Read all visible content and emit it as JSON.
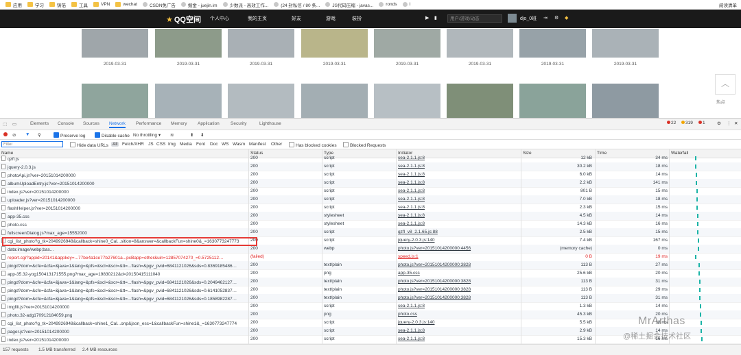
{
  "bookmarks": {
    "items": [
      "应用",
      "学习",
      "铸箔",
      "工具",
      "VPN",
      "wechat",
      "CSDN免广告",
      "掘金 - juejin.im",
      "少数派 - 高效工作...",
      "(24 封私信 / 80 条...",
      "JS代码压缩 - javas...",
      "ronds",
      "I"
    ],
    "right": "阅读清单"
  },
  "site_header": {
    "logo": "QQ空间",
    "nav": [
      "个人中心",
      "我的主页",
      "好友",
      "游戏",
      "装扮"
    ],
    "search_placeholder": "用户/游戏/动态",
    "username": "djo_0班"
  },
  "gallery": {
    "dates": [
      "2019-03-31",
      "2019-03-31",
      "2019-03-31",
      "2019-03-31",
      "2019-03-31",
      "2019-03-31",
      "2019-03-31",
      "2019-03-31"
    ],
    "side_label": "热点"
  },
  "devtools": {
    "tabs": [
      "Elements",
      "Console",
      "Sources",
      "Network",
      "Performance",
      "Memory",
      "Application",
      "Security",
      "Lighthouse"
    ],
    "badges": {
      "errors": "22",
      "warnings": "319",
      "issues": "1"
    },
    "toolbar": {
      "preserve_log": "Preserve log",
      "disable_cache": "Disable cache",
      "throttling": "No throttling"
    },
    "filter": {
      "placeholder": "Filter",
      "hide_data_urls": "Hide data URLs",
      "types": [
        "All",
        "Fetch/XHR",
        "JS",
        "CSS",
        "Img",
        "Media",
        "Font",
        "Doc",
        "WS",
        "Wasm",
        "Manifest",
        "Other"
      ],
      "blocked_cookies": "Has blocked cookies",
      "blocked_requests": "Blocked Requests"
    },
    "columns": {
      "name": "Name",
      "status": "Status",
      "type": "Type",
      "initiator": "Initiator",
      "size": "Size",
      "time": "Time",
      "waterfall": "Waterfall"
    },
    "rows": [
      {
        "name": "qzfl.js",
        "status": "200",
        "type": "script",
        "initiator": "sea-2.1.1.js:8",
        "size": "12 kB",
        "time": "34 ms"
      },
      {
        "name": "jquery-2.0.3.js",
        "status": "200",
        "type": "script",
        "initiator": "sea-2.1.1.js:8",
        "size": "30.2 kB",
        "time": "18 ms"
      },
      {
        "name": "photoApi.js?ver=20151014200000",
        "status": "200",
        "type": "script",
        "initiator": "sea-2.1.1.js:8",
        "size": "6.0 kB",
        "time": "14 ms"
      },
      {
        "name": "albumUploadEntry.js?ver=20151014200000",
        "status": "200",
        "type": "script",
        "initiator": "sea-2.1.1.js:8",
        "size": "2.2 kB",
        "time": "141 ms"
      },
      {
        "name": "index.js?ver=20151014200000",
        "status": "200",
        "type": "script",
        "initiator": "sea-2.1.1.js:8",
        "size": "801 B",
        "time": "15 ms"
      },
      {
        "name": "uploader.js?ver=20151014200000",
        "status": "200",
        "type": "script",
        "initiator": "sea-2.1.1.js:8",
        "size": "7.0 kB",
        "time": "18 ms"
      },
      {
        "name": "flashHelper.js?ver=20151014200000",
        "status": "200",
        "type": "script",
        "initiator": "sea-2.1.1.js:8",
        "size": "2.3 kB",
        "time": "15 ms"
      },
      {
        "name": "app-35.css",
        "status": "200",
        "type": "stylesheet",
        "initiator": "sea-2.1.1.js:8",
        "size": "4.5 kB",
        "time": "14 ms"
      },
      {
        "name": "photo.css",
        "status": "200",
        "type": "stylesheet",
        "initiator": "sea-2.1.1.js:8",
        "size": "14.3 kB",
        "time": "16 ms"
      },
      {
        "name": "fullscreenDialog.js?max_age=15552000",
        "status": "200",
        "type": "script",
        "initiator": "qzfl_v8_2.1.65.js:88",
        "size": "2.5 kB",
        "time": "15 ms"
      },
      {
        "name": "cgi_list_photo?g_tk=2049926948&callback=shine0_Cal...sition=8&answer=&callbackFun=shine0&_=1630773247773",
        "status": "200",
        "type": "script",
        "initiator": "jquery-2.0.3.js:140",
        "size": "7.4 kB",
        "time": "167 ms"
      },
      {
        "name": "data:image/webp;bas...",
        "status": "200",
        "type": "webp",
        "initiator": "photo.js?ver=20151014200000:4456",
        "size": "(memory cache)",
        "time": "0 ms"
      },
      {
        "name": "report.cgi?appid=20141&appkey=...77be4a1ce77b27601a...pcBapp=other&uin=12857074270_=0.5725112…",
        "status": "(failed)",
        "type": "",
        "initiator": "speed.js:1",
        "size": "0 B",
        "time": "19 ms",
        "error": true
      },
      {
        "name": "pingd?dom=&cfe=&cfa=&java=1&lang=&pfs=&scl=&scr=&tt=...flash=&pgv_pvid=6841121026&sds=0.8369185486…",
        "status": "200",
        "type": "text/plain",
        "initiator": "photo.js?ver=20151014200000:3828",
        "size": "113 B",
        "time": "27 ms"
      },
      {
        "name": "app-35.32-yog150413171555.png?max_age=19830212&d=20150415111040",
        "status": "200",
        "type": "png",
        "initiator": "app-35.css",
        "size": "25.6 kB",
        "time": "20 ms"
      },
      {
        "name": "pingd?dom=&cfe=&cfa=&java=1&lang=&pfs=&scl=&scr=&tt=...flash=&pgv_pvid=6841121026&sds=0.2049462127…",
        "status": "200",
        "type": "text/plain",
        "initiator": "photo.js?ver=20151014200000:3828",
        "size": "113 B",
        "time": "31 ms"
      },
      {
        "name": "pingd?dom=&cfe=&cfa=&java=1&lang=&pfs=&scl=&scr=&tt=...flash=&pgv_pvid=6841121026&sds=0.6141052837…",
        "status": "200",
        "type": "text/plain",
        "initiator": "photo.js?ver=20151014200000:3828",
        "size": "113 B",
        "time": "29 ms"
      },
      {
        "name": "pingd?dom=&cfe=&cfa=&java=1&lang=&pfs=&scl=&scr=&tt=...flash=&pgv_pvid=6841121026&sds=0.1858982287…",
        "status": "200",
        "type": "text/plain",
        "initiator": "photo.js?ver=20151014200000:3828",
        "size": "113 B",
        "time": "31 ms"
      },
      {
        "name": "imgfili.js?ver=20151014200000",
        "status": "200",
        "type": "script",
        "initiator": "sea-2.1.1.js:8",
        "size": "1.3 kB",
        "time": "14 ms"
      },
      {
        "name": "photo.32-adg170912184059.png",
        "status": "200",
        "type": "png",
        "initiator": "photo.css",
        "size": "45.3 kB",
        "time": "20 ms"
      },
      {
        "name": "cgi_list_photo?g_tk=2049926948&callback=shine1_Cal...onp&json_esc=1&callbackFun=shine1&_=1630773247774",
        "status": "200",
        "type": "script",
        "initiator": "jquery-2.0.3.js:140",
        "size": "5.5 kB",
        "time": "18 ms"
      },
      {
        "name": "pager.js?ver=20151014200000",
        "status": "200",
        "type": "script",
        "initiator": "sea-2.1.1.js:8",
        "size": "2.9 kB",
        "time": "14 ms"
      },
      {
        "name": "index.js?ver=20151014200000",
        "status": "200",
        "type": "script",
        "initiator": "sea-2.1.1.js:8",
        "size": "15.3 kB",
        "time": "16 ms"
      }
    ],
    "status_bar": {
      "requests": "157 requests",
      "transferred": "1.5 MB transferred",
      "resources": "2.4 MB resources"
    }
  },
  "watermark": {
    "title": "MrArthas",
    "subtitle": "@稀土掘金技术社区"
  },
  "colors": {
    "accent": "#1a73e8",
    "error": "#e53935",
    "header_bg": "#1a1a1a",
    "waterfall": "#1ab3a6"
  }
}
